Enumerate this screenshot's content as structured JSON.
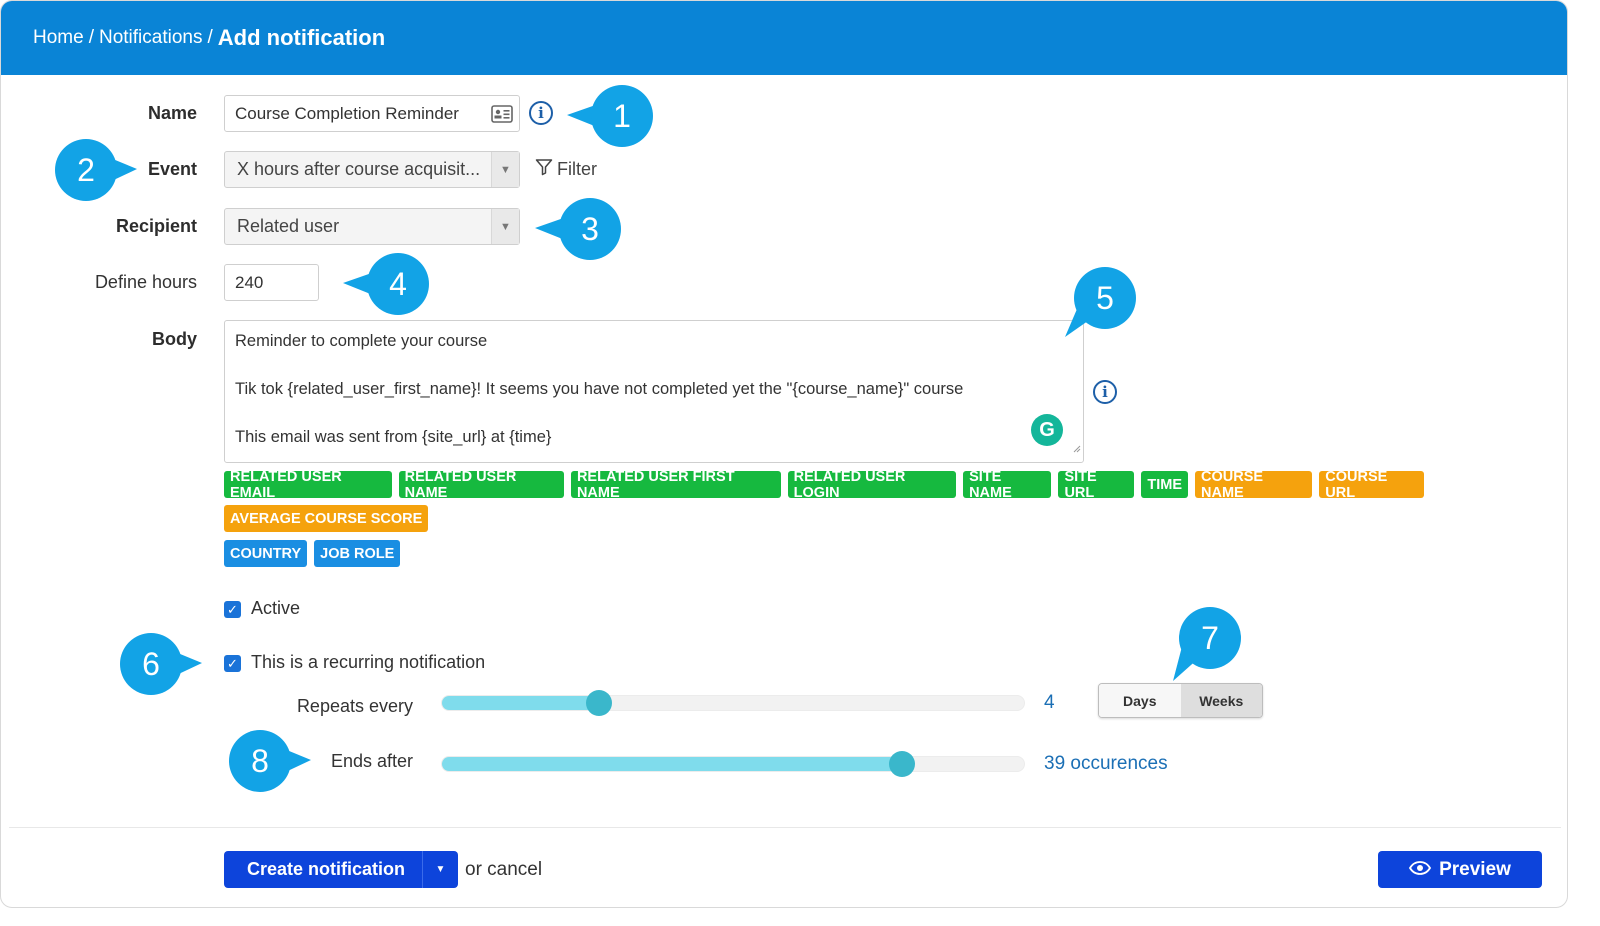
{
  "breadcrumb": {
    "home": "Home",
    "notifications": "Notifications",
    "current": "Add notification",
    "separator": "/"
  },
  "form": {
    "name_label": "Name",
    "name_value": "Course Completion Reminder",
    "event_label": "Event",
    "event_value": "X hours after course acquisit...",
    "filter_label": "Filter",
    "recipient_label": "Recipient",
    "recipient_value": "Related user",
    "hours_label": "Define hours",
    "hours_value": "240",
    "body_label": "Body",
    "body_lines": [
      "Reminder to complete your course",
      "",
      "Tik tok {related_user_first_name}! It seems you have not completed yet the  \"{course_name}\" course",
      "",
      "This email was sent from {site_url} at {time}"
    ],
    "grammarly_glyph": "G"
  },
  "tags": {
    "row1": [
      "RELATED USER EMAIL",
      "RELATED USER NAME",
      "RELATED USER FIRST NAME",
      "RELATED USER LOGIN",
      "SITE NAME",
      "SITE URL",
      "TIME"
    ],
    "row1_orange": [
      "COURSE NAME",
      "COURSE URL"
    ],
    "row2_orange": [
      "AVERAGE COURSE SCORE"
    ],
    "row3_blue": [
      "COUNTRY",
      "JOB ROLE"
    ]
  },
  "options": {
    "active_label": "Active",
    "active_checked": true,
    "recurring_label": "This is a recurring notification",
    "recurring_checked": true,
    "repeats_label": "Repeats every",
    "repeats_value": "4",
    "repeats_level": 0.27,
    "unit_days": "Days",
    "unit_weeks": "Weeks",
    "unit_selected": "Weeks",
    "ends_label": "Ends after",
    "ends_value": "39 occurences",
    "ends_level": 0.79
  },
  "footer": {
    "create_label": "Create notification",
    "or_cancel": "or cancel",
    "preview_label": "Preview"
  },
  "callouts": [
    "1",
    "2",
    "3",
    "4",
    "5",
    "6",
    "7",
    "8"
  ],
  "colors": {
    "header": "#0a84d6",
    "callout": "#12a3e6",
    "tag_green": "#16b93f",
    "tag_orange": "#f5a20d",
    "tag_blue": "#1a8ee2",
    "primary_button": "#0d44db",
    "slider_fill": "#7fdcec",
    "slider_thumb": "#3ab7cb"
  },
  "icons": {
    "info": "info-icon",
    "contact_card": "contact-card-icon",
    "filter": "filter-icon",
    "eye": "eye-icon",
    "caret": "caret-down-icon",
    "check": "checkmark-icon"
  }
}
